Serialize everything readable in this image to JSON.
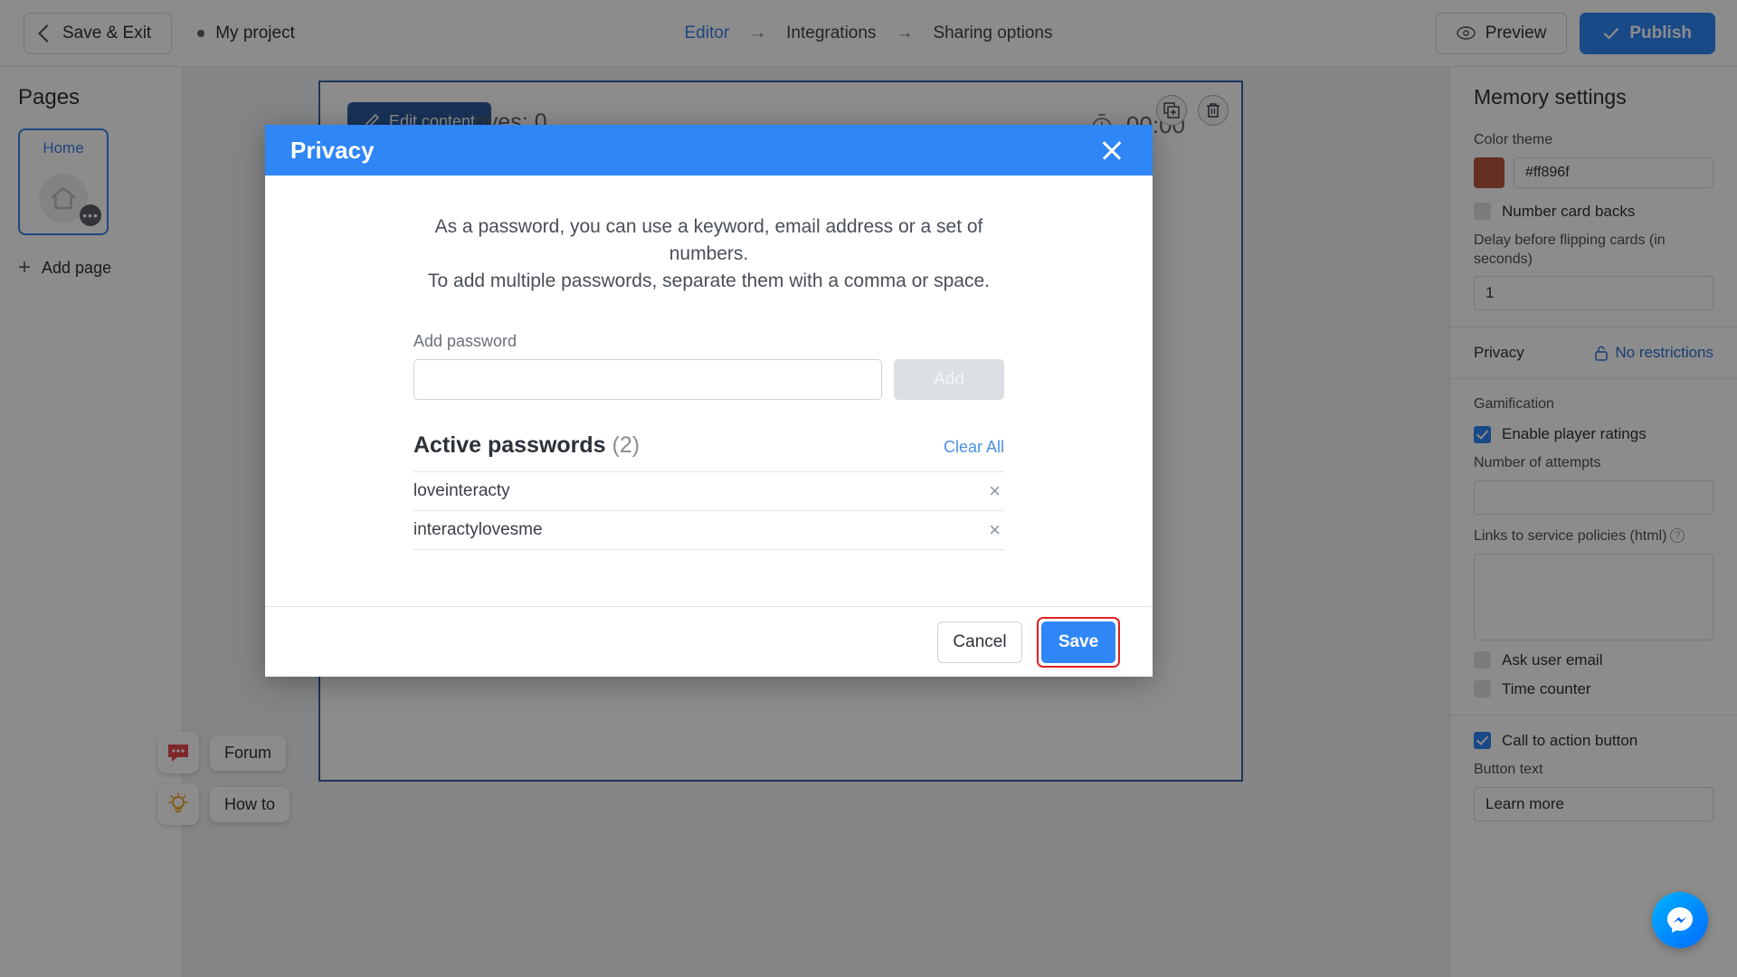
{
  "topbar": {
    "save_exit": "Save & Exit",
    "project_name": "My project",
    "breadcrumb": [
      {
        "label": "Editor",
        "active": true
      },
      {
        "label": "Integrations",
        "active": false
      },
      {
        "label": "Sharing options",
        "active": false
      }
    ],
    "arrow": "→",
    "preview": "Preview",
    "publish": "Publish"
  },
  "sidebar": {
    "title": "Pages",
    "page_card_label": "Home",
    "page_card_badge": "•••",
    "add_page": "Add page"
  },
  "canvas": {
    "edit_content": "Edit content",
    "moves": "oves: 0",
    "timer": "00:00",
    "forum": "Forum",
    "how_to": "How to"
  },
  "right_panel": {
    "title": "Memory settings",
    "color_theme_label": "Color theme",
    "color_theme_value": "#ff896f",
    "color_theme_hex": "#b9543f",
    "number_card_backs": "Number card backs",
    "number_card_backs_checked": false,
    "delay_label": "Delay before flipping cards (in seconds)",
    "delay_value": "1",
    "privacy_label": "Privacy",
    "privacy_value": "No restrictions",
    "gamification_label": "Gamification",
    "enable_ratings": "Enable player ratings",
    "enable_ratings_checked": true,
    "attempts_label": "Number of attempts",
    "attempts_value": "",
    "policies_label": "Links to service policies (html)",
    "ask_user_email": "Ask user email",
    "ask_user_email_checked": false,
    "time_counter": "Time counter",
    "time_counter_checked": false,
    "cta_button": "Call to action button",
    "cta_button_checked": true,
    "button_text_label": "Button text",
    "button_text_value": "Learn more"
  },
  "modal": {
    "title": "Privacy",
    "description_line1": "As a password, you can use a keyword, email address or a set of numbers.",
    "description_line2": "To add multiple passwords, separate them with a comma or space.",
    "add_password_label": "Add password",
    "password_input_value": "",
    "password_input_placeholder": "",
    "add_button": "Add",
    "list_title": "Active passwords",
    "list_count": "(2)",
    "clear_all": "Clear All",
    "passwords": [
      {
        "value": "loveinteracty",
        "remove": "×"
      },
      {
        "value": "interactylovesme",
        "remove": "×"
      }
    ],
    "cancel": "Cancel",
    "save": "Save"
  },
  "colors": {
    "accent_blue": "#2f86f6",
    "link_blue": "#4a90e8",
    "highlight_red": "#e02020"
  }
}
